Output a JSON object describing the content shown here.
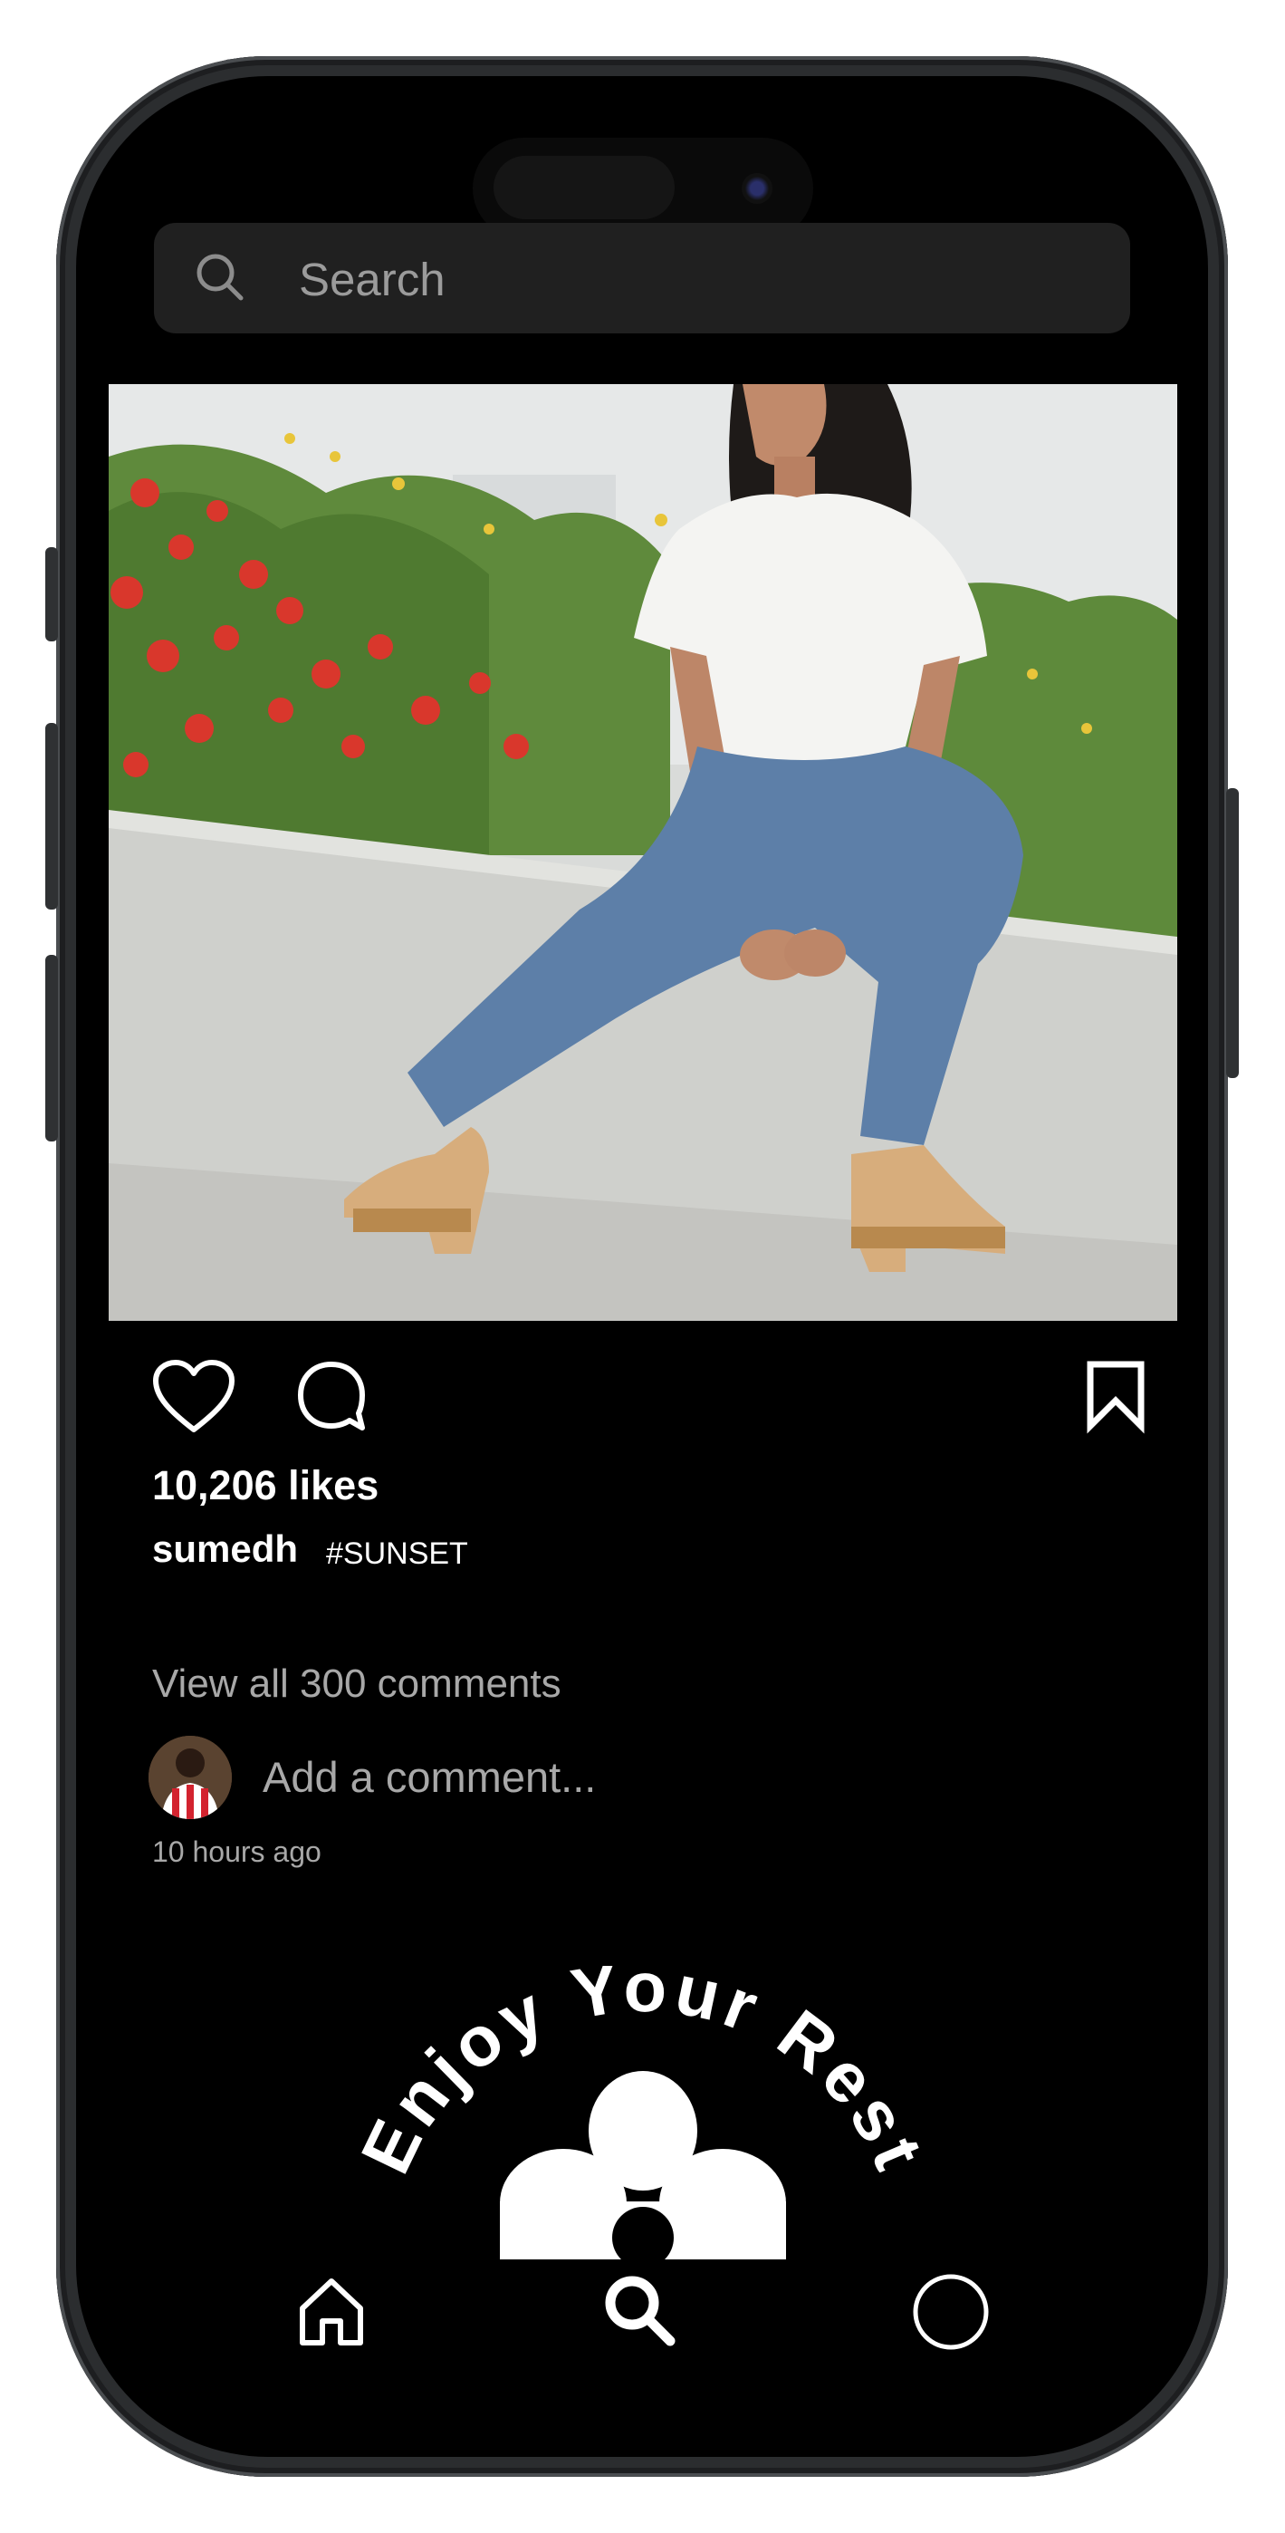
{
  "search": {
    "placeholder": "Search"
  },
  "post": {
    "likes_text": "10,206 likes",
    "username": "sumedh",
    "hashtag": "#SUNSET",
    "view_comments_text": "View all 300 comments",
    "add_comment_placeholder": "Add a comment...",
    "timestamp": "10 hours ago"
  },
  "logo": {
    "arc_text": "Enjoy Your Rest"
  },
  "icons": {
    "search": "search-icon",
    "like": "heart-icon",
    "comment": "comment-bubble-icon",
    "save": "bookmark-icon",
    "home": "home-icon",
    "explore": "search-icon",
    "profile": "circle-icon"
  },
  "colors": {
    "background": "#000000",
    "search_bar": "#202020",
    "text_primary": "#ffffff",
    "text_secondary": "#a8a8a8",
    "phone_frame": "#2b2d2f"
  }
}
